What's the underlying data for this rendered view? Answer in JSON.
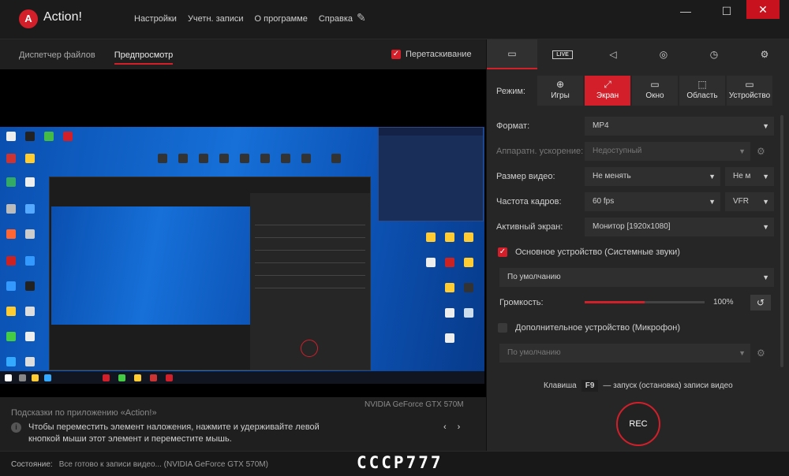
{
  "app": {
    "logo_letter": "A",
    "title": "Action!"
  },
  "menu": [
    "Настройки",
    "Учетн. записи",
    "О программе",
    "Справка"
  ],
  "window_controls": {
    "minimize": "—",
    "maximize": "☐",
    "close": "✕"
  },
  "left_tabs": [
    "Диспетчер файлов",
    "Предпросмотр"
  ],
  "drag_option": {
    "label": "Перетаскивание",
    "checked": true
  },
  "gpu": "NVIDIA GeForce GTX 570M",
  "hints": {
    "title": "Подсказки по приложению «Action!»",
    "text": "Чтобы переместить элемент наложения, нажмите и удерживайте левой кнопкой мыши этот элемент и переместите мышь.",
    "prev": "‹",
    "next": "›"
  },
  "status": {
    "label": "Состояние:",
    "text": "Все готово к записи видео...  (NVIDIA GeForce GTX 570M)"
  },
  "watermark": "CCCP777",
  "right_tabs": [
    {
      "name": "video",
      "glyph": "▭"
    },
    {
      "name": "live",
      "glyph": "LIVE"
    },
    {
      "name": "audio",
      "glyph": "◁"
    },
    {
      "name": "screenshot",
      "glyph": "◎"
    },
    {
      "name": "timer",
      "glyph": "◷"
    },
    {
      "name": "settings",
      "glyph": "⚙"
    }
  ],
  "mode": {
    "label": "Режим:",
    "options": [
      {
        "label": "Игры",
        "glyph": "⊕"
      },
      {
        "label": "Экран",
        "glyph": "⤢"
      },
      {
        "label": "Окно",
        "glyph": "▭"
      },
      {
        "label": "Область",
        "glyph": "⬚"
      },
      {
        "label": "Устройство",
        "glyph": "▭"
      }
    ],
    "selected": "Экран"
  },
  "settings": {
    "format": {
      "label": "Формат:",
      "value": "MP4"
    },
    "hw_accel": {
      "label": "Аппаратн. ускорение:",
      "value": "Недоступный"
    },
    "video_size": {
      "label": "Размер видео:",
      "value": "Не менять",
      "value2": "Не м"
    },
    "fps": {
      "label": "Частота кадров:",
      "value": "60 fps",
      "value2": "VFR"
    },
    "active_screen": {
      "label": "Активный экран:",
      "value": "Монитор [1920x1080]"
    },
    "main_device": {
      "label": "Основное устройство (Системные звуки)",
      "checked": true,
      "value": "По умолчанию"
    },
    "volume": {
      "label": "Громкость:",
      "percent": 100,
      "display": "100%"
    },
    "extra_device": {
      "label": "Дополнительное устройство (Микрофон)",
      "checked": false,
      "value": "По умолчанию"
    }
  },
  "hotkey": {
    "prefix": "Клавиша",
    "key": "F9",
    "suffix": "— запуск (остановка) записи видео"
  },
  "rec_label": "REC",
  "colors": {
    "accent": "#d21f2a",
    "panel": "#262626",
    "bg": "#1f1f1f"
  }
}
